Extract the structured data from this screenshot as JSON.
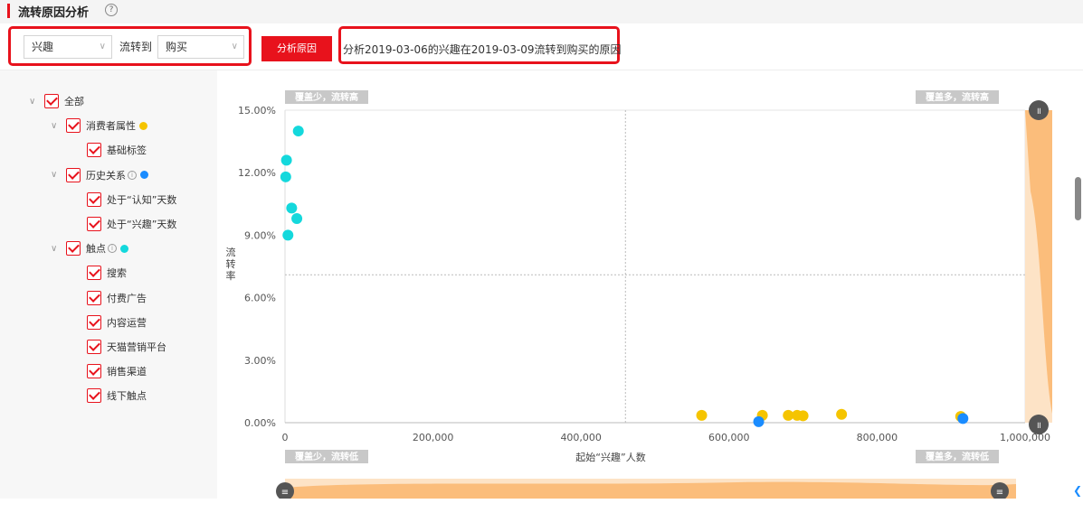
{
  "header": {
    "title": "流转原因分析",
    "help_icon": "?"
  },
  "toolbar": {
    "from_select": "兴趣",
    "to_label": "流转到",
    "to_select": "购买",
    "analyze_button": "分析原因",
    "description": "分析2019-03-06的兴趣在2019-03-09流转到购买的原因"
  },
  "tree": {
    "items": [
      {
        "label": "全部",
        "toggle": "∨",
        "level": 0,
        "dot": null,
        "info": false
      },
      {
        "label": "消费者属性",
        "toggle": "∨",
        "level": 1,
        "dot": "#f5c400",
        "info": false
      },
      {
        "label": "基础标签",
        "toggle": "",
        "level": 2,
        "dot": null,
        "info": false
      },
      {
        "label": "历史关系",
        "toggle": "∨",
        "level": 1,
        "dot": "#1a8cff",
        "info": true
      },
      {
        "label": "处于“认知”天数",
        "toggle": "",
        "level": 2,
        "dot": null,
        "info": false
      },
      {
        "label": "处于“兴趣”天数",
        "toggle": "",
        "level": 2,
        "dot": null,
        "info": false
      },
      {
        "label": "触点",
        "toggle": "∨",
        "level": 1,
        "dot": "#14d8dc",
        "info": true
      },
      {
        "label": "搜索",
        "toggle": "",
        "level": 2,
        "dot": null,
        "info": false
      },
      {
        "label": "付费广告",
        "toggle": "",
        "level": 2,
        "dot": null,
        "info": false
      },
      {
        "label": "内容运营",
        "toggle": "",
        "level": 2,
        "dot": null,
        "info": false
      },
      {
        "label": "天猫营销平台",
        "toggle": "",
        "level": 2,
        "dot": null,
        "info": false
      },
      {
        "label": "销售渠道",
        "toggle": "",
        "level": 2,
        "dot": null,
        "info": false
      },
      {
        "label": "线下触点",
        "toggle": "",
        "level": 2,
        "dot": null,
        "info": false
      }
    ]
  },
  "chart_data": {
    "type": "scatter",
    "xlabel": "起始“兴趣”人数",
    "ylabel": "流转率",
    "xlim": [
      0,
      1000000
    ],
    "ylim": [
      0,
      15
    ],
    "x_ticks": [
      "0",
      "200,000",
      "400,000",
      "600,000",
      "800,000",
      "1,000,000"
    ],
    "y_ticks": [
      "0.00%",
      "3.00%",
      "6.00%",
      "9.00%",
      "12.00%",
      "15.00%"
    ],
    "quadrants": {
      "top_left": "覆盖少，流转高",
      "top_right": "覆盖多，流转高",
      "bottom_left": "覆盖少，流转低",
      "bottom_right": "覆盖多，流转低"
    },
    "divider": {
      "x": 460000,
      "y": 7.1
    },
    "series": [
      {
        "color": "#14d8dc",
        "points": [
          [
            18000,
            14.0
          ],
          [
            2000,
            12.6
          ],
          [
            1000,
            11.8
          ],
          [
            9000,
            10.3
          ],
          [
            16000,
            9.8
          ],
          [
            4000,
            9.0
          ]
        ]
      },
      {
        "color": "#f5c400",
        "points": [
          [
            563000,
            0.35
          ],
          [
            645000,
            0.35
          ],
          [
            680000,
            0.35
          ],
          [
            692000,
            0.35
          ],
          [
            700000,
            0.33
          ],
          [
            752000,
            0.4
          ],
          [
            913000,
            0.3
          ]
        ]
      },
      {
        "color": "#1a8cff",
        "points": [
          [
            640000,
            0.05
          ],
          [
            916000,
            0.2
          ]
        ]
      }
    ]
  }
}
